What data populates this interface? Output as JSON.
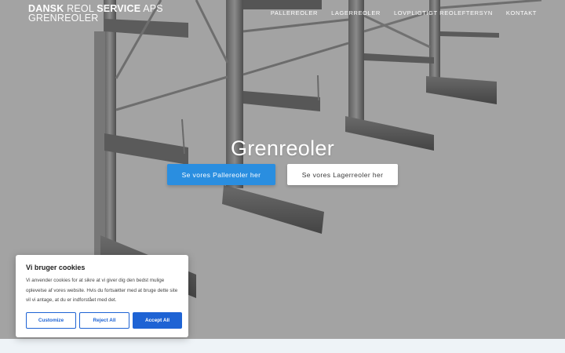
{
  "brand": {
    "bold1": "DANSK",
    "light1": " REOL ",
    "bold2": "SERVICE",
    "light2": " APS",
    "line2": "GRENREOLER"
  },
  "nav": [
    "PALLEREOLER",
    "LAGERREOLER",
    "LOVPLIGTIGT REOLEFTERSYN",
    "KONTAKT"
  ],
  "hero": {
    "title": "Grenreoler",
    "primary_button": "Se vores Pallereoler her",
    "secondary_button": "Se vores Lagerreoler her"
  },
  "cookie": {
    "title": "Vi bruger cookies",
    "text": "Vi anvender cookies for at sikre at vi giver dig den bedst mulige oplevelse af vores website. Hvis du fortsætter med at bruge dette site vil vi antage, at du er indforstået med det.",
    "customize": "Customize",
    "reject": "Reject All",
    "accept": "Accept All"
  },
  "colors": {
    "primary": "#2a8ee0",
    "cookie_accent": "#1e63d4",
    "hero_bg": "#a3a3a3"
  }
}
